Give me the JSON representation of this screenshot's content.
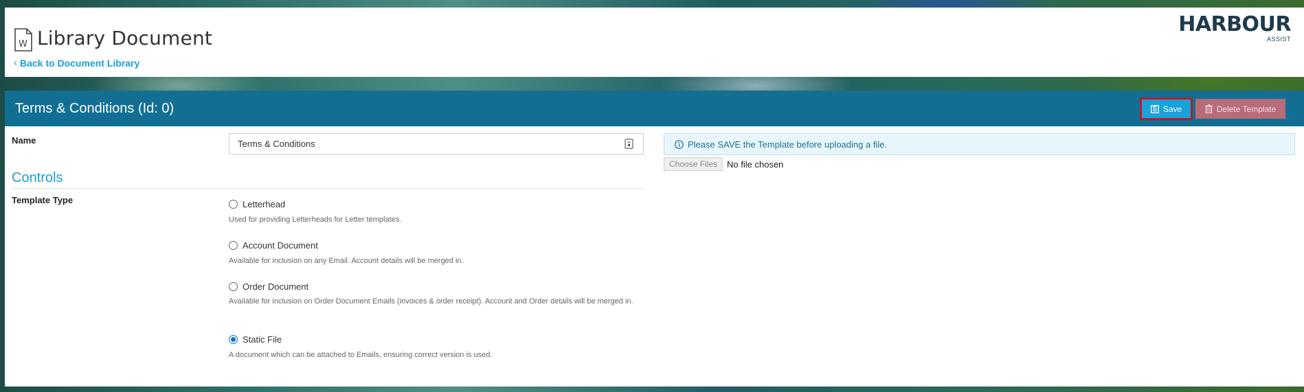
{
  "header": {
    "icon": "word-document-icon",
    "icon_letter": "W",
    "title": "Library Document",
    "back_link": "Back to Document Library",
    "logo_main": "HARBOUR",
    "logo_sub": "ASSIST"
  },
  "panel": {
    "title": "Terms & Conditions (Id: 0)",
    "save_label": "Save",
    "delete_label": "Delete Template",
    "colors": {
      "header": "#126f93",
      "save": "#1aa2d9",
      "delete": "#b86b78",
      "highlight": "#c0182a"
    }
  },
  "form": {
    "name_label": "Name",
    "name_value": "Terms & Conditions",
    "section_title": "Controls",
    "template_type_label": "Template Type",
    "template_types": [
      {
        "label": "Letterhead",
        "help": "Used for providing Letterheads for Letter templates.",
        "checked": false
      },
      {
        "label": "Account Document",
        "help": "Available for inclusion on any Email. Account details will be merged in.",
        "checked": false
      },
      {
        "label": "Order Document",
        "help": "Available for inclusion on Order Document Emails (invoices & order receipt). Account and Order details will be merged in.",
        "checked": false
      },
      {
        "label": "Static File",
        "help": "A document which can be attached to Emails, ensuring correct version is used.",
        "checked": true
      }
    ]
  },
  "upload": {
    "alert_icon": "info-circle-icon",
    "alert_text": "Please SAVE the Template before uploading a file.",
    "choose_label": "Choose Files",
    "no_file_text": "No file chosen"
  }
}
